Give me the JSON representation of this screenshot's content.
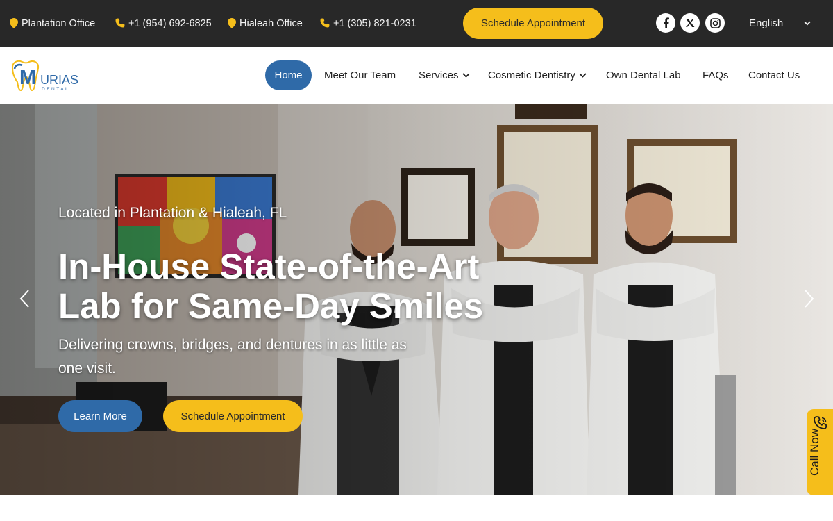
{
  "topbar": {
    "plantation_label": "Plantation Office",
    "plantation_phone": "+1 (954) 692-6825",
    "hialeah_label": "Hialeah Office",
    "hialeah_phone": "+1 (305) 821-0231",
    "cta_label": "Schedule Appointment",
    "social": [
      "facebook-icon",
      "x-icon",
      "instagram-icon"
    ],
    "language": "English"
  },
  "brand": {
    "logo_text": "URIAS",
    "logo_sub": "DENTAL"
  },
  "nav": {
    "items": [
      {
        "label": "Home",
        "active": true
      },
      {
        "label": "Meet Our Team"
      },
      {
        "label": "Services",
        "dropdown": true
      },
      {
        "label": "Cosmetic Dentistry",
        "dropdown": true
      },
      {
        "label": "Own Dental Lab"
      },
      {
        "label": "FAQs"
      },
      {
        "label": "Contact Us"
      }
    ]
  },
  "hero": {
    "subtitle": "Located in Plantation & Hialeah, FL",
    "title_line1": "In-House State-of-the-Art",
    "title_line2": "Lab for Same-Day Smiles",
    "description": "Delivering crowns, bridges, and dentures in as little as one visit.",
    "learn_more": "Learn More",
    "schedule": "Schedule Appointment"
  },
  "call_now": {
    "label": "Call Now"
  },
  "colors": {
    "topbar_bg": "#282828",
    "accent_yellow": "#f5be1b",
    "accent_blue": "#2f6aa8"
  }
}
